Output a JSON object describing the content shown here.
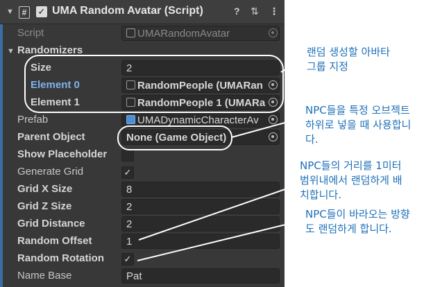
{
  "header": {
    "title": "UMA Random Avatar (Script)",
    "help_icon": "question-icon",
    "preset_icon": "sliders-icon",
    "menu_icon": "kebab-icon"
  },
  "fields": {
    "script_label": "Script",
    "script_value": "UMARandomAvatar",
    "randomizers_label": "Randomizers",
    "size_label": "Size",
    "size_value": "2",
    "element0_label": "Element 0",
    "element0_value": "RandomPeople (UMARan",
    "element1_label": "Element 1",
    "element1_value": "RandomPeople 1 (UMARa",
    "prefab_label": "Prefab",
    "prefab_value": "UMADynamicCharacterAv",
    "parent_label": "Parent Object",
    "parent_value": "None (Game Object)",
    "placeholder_label": "Show Placeholder",
    "generate_label": "Generate Grid",
    "gridx_label": "Grid X Size",
    "gridx_value": "8",
    "gridz_label": "Grid Z Size",
    "gridz_value": "2",
    "griddist_label": "Grid Distance",
    "griddist_value": "2",
    "offset_label": "Random Offset",
    "offset_value": "1",
    "rotation_label": "Random Rotation",
    "namebase_label": "Name Base",
    "namebase_value": "Pat"
  },
  "annotations": {
    "a1_line1": "랜덤 생성할 아바타",
    "a1_line2": "그룹 지정",
    "a2_line1": "NPC들을 특정 오브젝트",
    "a2_line2": "하위로 넣을 때 사용합니",
    "a2_line3": "다.",
    "a3_line1": "NPC들의 거리를 1미터",
    "a3_line2": "범위내에서 랜덤하게 배",
    "a3_line3": "치합니다.",
    "a4_line1": "NPC들이 바라오는 방향",
    "a4_line2": "도 랜덤하게 합니다."
  },
  "colors": {
    "panel": "#383838",
    "accent": "#3d6ea3",
    "annotation": "#1d6fb8"
  }
}
